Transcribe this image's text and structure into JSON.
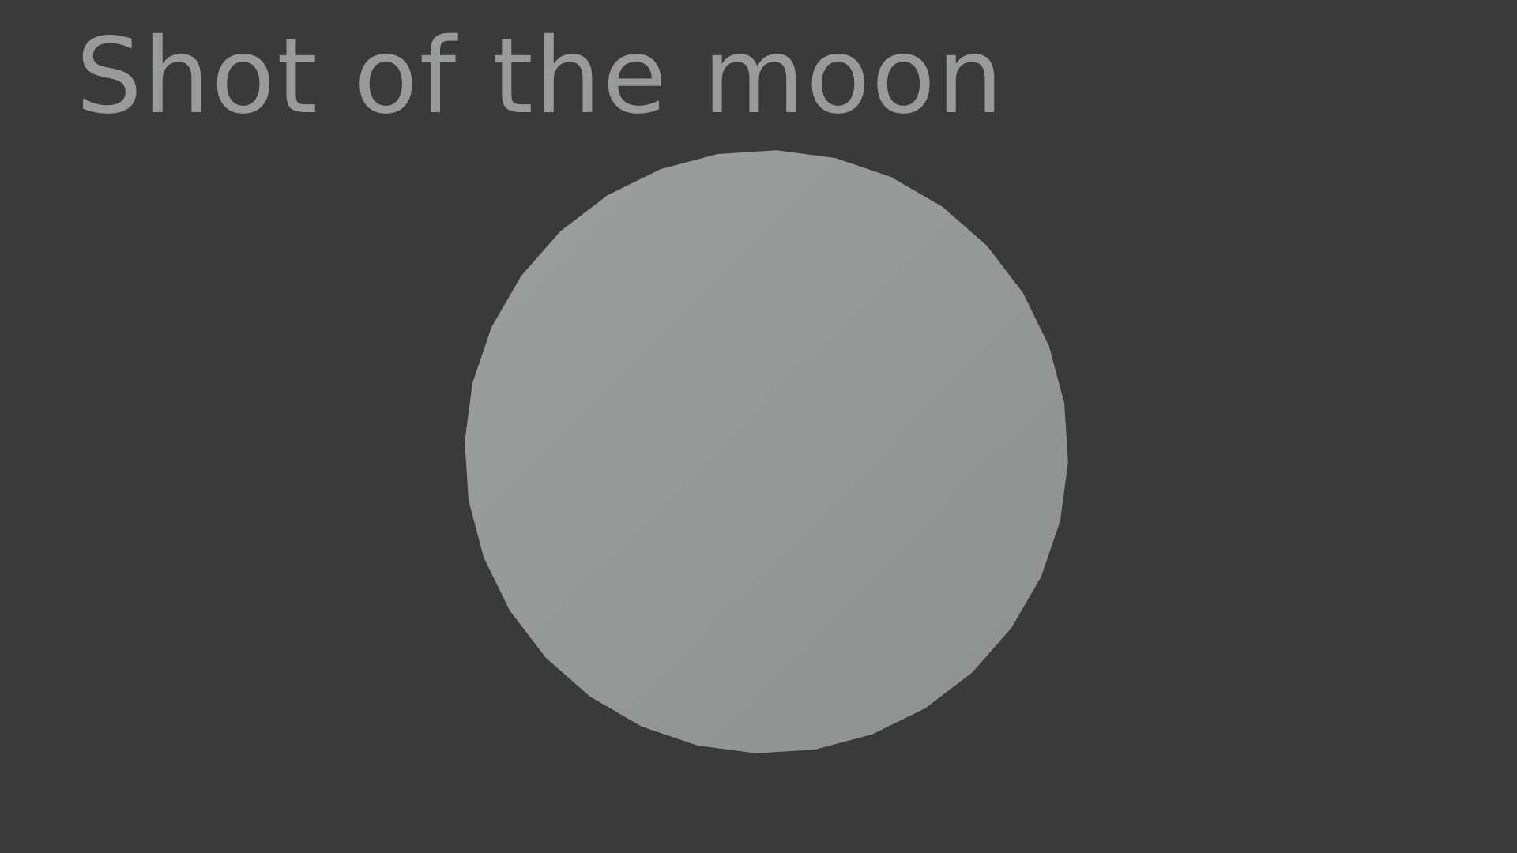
{
  "caption": {
    "text": "Shot of the moon"
  },
  "colors": {
    "background": "#3a3a3a",
    "caption_text": "#999a9a",
    "moon_fill_light": "#9d9e9e",
    "moon_fill_dark": "#8f9191"
  },
  "moon": {
    "shape": "low-poly-circle",
    "segments": 32
  }
}
